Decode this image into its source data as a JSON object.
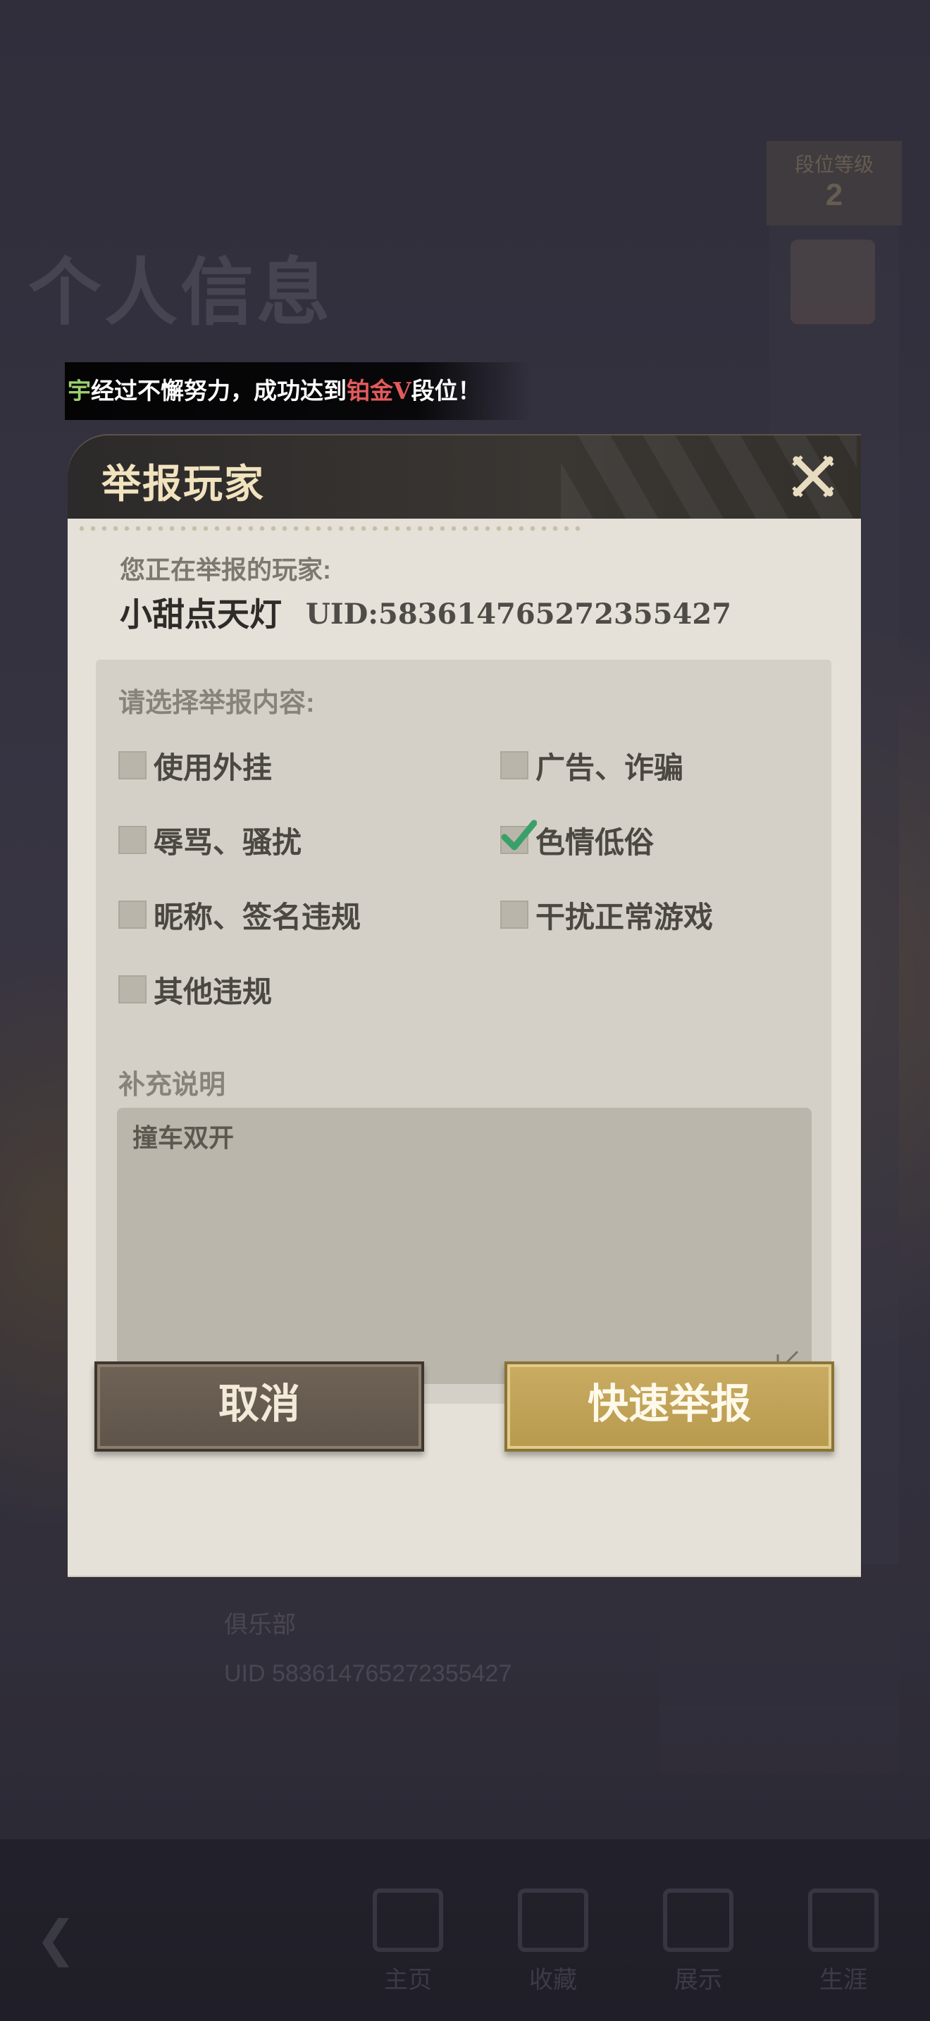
{
  "background": {
    "page_title": "个人信息",
    "page_title_sub": "",
    "rank_label": "段位等级",
    "rank_value": "2",
    "club": "俱乐部",
    "uid_line": "UID 583614765272355427",
    "nav_items": [
      "主页",
      "收藏",
      "展示",
      "生涯"
    ]
  },
  "banner": {
    "prefix": "宇",
    "text1": "经过不懈努力，成功达到",
    "rank": "铂金V",
    "text2": "段位！"
  },
  "dialog": {
    "title": "举报玩家",
    "reporting_label": "您正在举报的玩家:",
    "player_name": "小甜点天灯",
    "player_uid": "UID:583614765272355427",
    "select_label": "请选择举报内容:",
    "options": [
      {
        "label": "使用外挂",
        "checked": false
      },
      {
        "label": "广告、诈骗",
        "checked": false
      },
      {
        "label": "辱骂、骚扰",
        "checked": false
      },
      {
        "label": "色情低俗",
        "checked": true
      },
      {
        "label": "昵称、签名违规",
        "checked": false
      },
      {
        "label": "干扰正常游戏",
        "checked": false
      },
      {
        "label": "其他违规",
        "checked": false
      }
    ],
    "supplement_label": "补充说明",
    "supplement_value": "撞车双开",
    "cancel_label": "取消",
    "submit_label": "快速举报"
  },
  "colors": {
    "accent_gold": "#c9ac62",
    "header_dark": "#2c2a2a",
    "check_green": "#3aa06a",
    "banner_rank_red": "#e35b5b"
  },
  "icons": [
    "close-icon",
    "checkbox-icon",
    "check-icon",
    "edit-icon",
    "back-icon"
  ]
}
